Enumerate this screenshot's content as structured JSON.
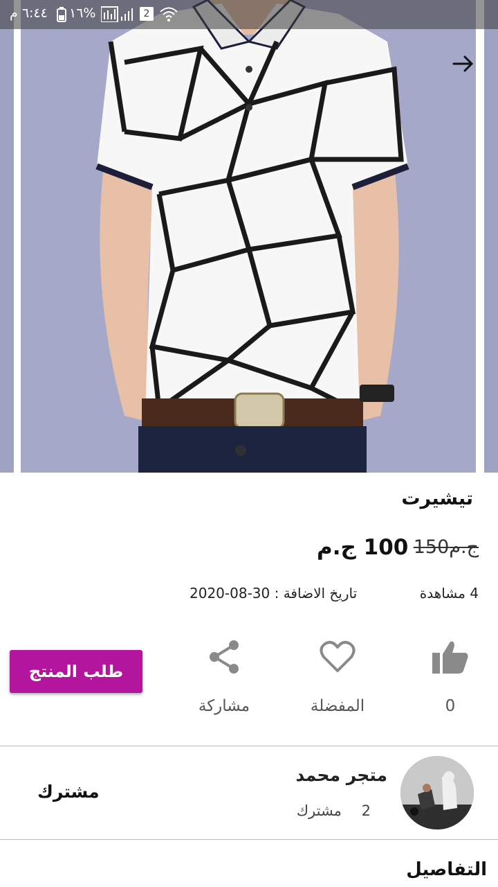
{
  "status_bar": {
    "time": "٦:٤٤ م",
    "battery": "%١٦",
    "sim_badge": "2"
  },
  "product": {
    "title": "تيشيرت",
    "old_price": "150ج.م",
    "new_price": "100 ج.م",
    "views": "4 مشاهدة",
    "date_added": "تاريخ الاضافة : 30-08-2020"
  },
  "actions": {
    "likes_count": "0",
    "favorite_label": "المفضلة",
    "share_label": "مشاركة",
    "order_button": "طلب المنتج"
  },
  "store": {
    "name": "متجر محمد",
    "subscribers_count": "2",
    "subscribers_label": "مشترك",
    "subscribe_button": "مشترك"
  },
  "section": {
    "details_title": "التفاصيل"
  },
  "colors": {
    "accent": "#b3159f",
    "icon_gray": "#8a8a8a"
  }
}
